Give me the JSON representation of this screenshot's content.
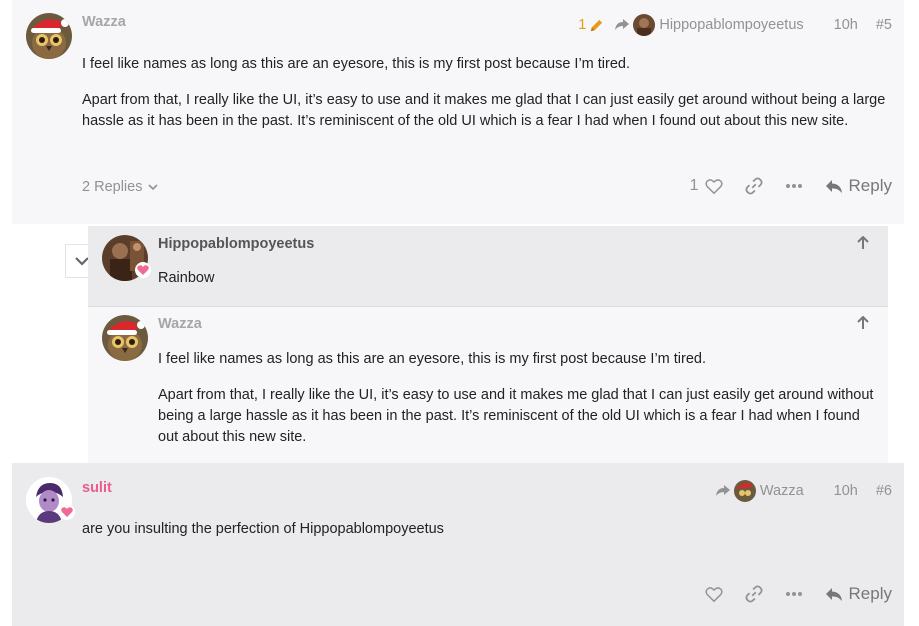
{
  "post5": {
    "username": "Wazza",
    "edit_count": "1",
    "reply_to_user": "Hippopablompoyeetus",
    "time": "10h",
    "post_number": "#5",
    "paragraphs": [
      "I feel like names as long as this are an eyesore, this is my first post because I’m tired.",
      "Apart from that, I really like the UI, it’s easy to use and it makes me glad that I can just easily get around without being a large hassle as it has been in the past. It’s reminiscent of the old UI which is a fear I had when I found out about this new site."
    ],
    "replies_label": "2 Replies",
    "like_count": "1",
    "reply_label": "Reply"
  },
  "embedded": [
    {
      "username": "Hippopablompoyeetus",
      "paragraphs": [
        "Rainbow"
      ]
    },
    {
      "username": "Wazza",
      "paragraphs": [
        "I feel like names as long as this are an eyesore, this is my first post because I’m tired.",
        "Apart from that, I really like the UI, it’s easy to use and it makes me glad that I can just easily get around without being a large hassle as it has been in the past. It’s reminiscent of the old UI which is a fear I had when I found out about this new site."
      ]
    }
  ],
  "post6": {
    "username": "sulit",
    "reply_to_user": "Wazza",
    "time": "10h",
    "post_number": "#6",
    "paragraphs": [
      "are you insulting the perfection of Hippopablompoyeetus"
    ],
    "reply_label": "Reply"
  },
  "colors": {
    "username_gray": "#a6a6a6",
    "username_pink": "#e95d8c",
    "edit_orange": "#e59c1a",
    "meta_gray": "#929292"
  },
  "icons": [
    "pencil-icon",
    "share-reply-icon",
    "chevron-down-icon",
    "heart-icon",
    "link-icon",
    "more-icon",
    "reply-icon",
    "up-arrow-icon",
    "heart-badge-icon"
  ]
}
